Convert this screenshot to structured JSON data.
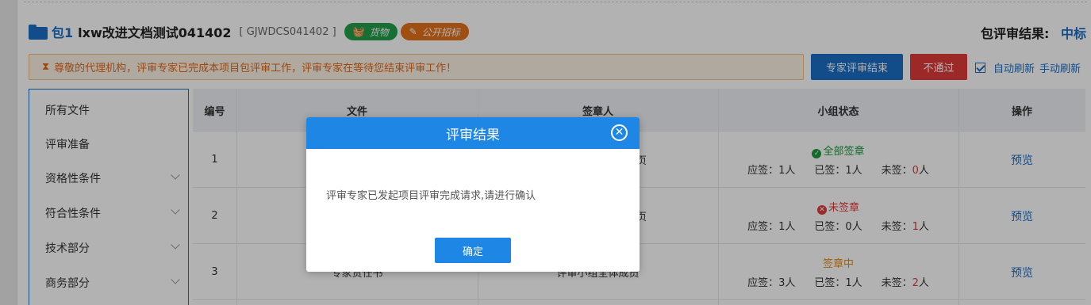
{
  "header": {
    "package_label": "包1",
    "project_name": "lxw改进文档测试041402",
    "project_code": "[ GJWDCS041402 ]",
    "tags": [
      {
        "label": "货物",
        "icon": "basket-icon",
        "color": "#21a04a"
      },
      {
        "label": "公开招标",
        "icon": "pen-icon",
        "color": "#e4711b"
      }
    ],
    "result_label": "包评审结果:",
    "result_value": "中标"
  },
  "notice": {
    "icon": "hourglass-icon",
    "text": "尊敬的代理机构，评审专家已完成本项目包评审工作，评审专家在等待您结束评审工作！"
  },
  "actions": {
    "finish_label": "专家评审结束",
    "reject_label": "不通过",
    "auto_refresh_label": "自动刷新",
    "auto_refresh_checked": true,
    "manual_refresh_label": "手动刷新"
  },
  "sidebar": {
    "items": [
      {
        "label": "所有文件",
        "expandable": false
      },
      {
        "label": "评审准备",
        "expandable": false
      },
      {
        "label": "资格性条件",
        "expandable": true
      },
      {
        "label": "符合性条件",
        "expandable": true
      },
      {
        "label": "技术部分",
        "expandable": true
      },
      {
        "label": "商务部分",
        "expandable": true
      }
    ]
  },
  "table": {
    "headers": [
      "编号",
      "文件",
      "签章人",
      "小组状态",
      "操作"
    ],
    "rows": [
      {
        "no": "1",
        "file": "",
        "signer": "页",
        "status": "全部签章",
        "status_type": "done",
        "required": "应签：1人",
        "signed": "已签：1人",
        "unsigned_label": "未签：",
        "unsigned_value": "0",
        "unsigned_unit": "人",
        "action": "预览"
      },
      {
        "no": "2",
        "file": "",
        "signer": "页",
        "status": "未签章",
        "status_type": "none",
        "required": "应签：1人",
        "signed": "已签：0人",
        "unsigned_label": "未签：",
        "unsigned_value": "1",
        "unsigned_unit": "人",
        "action": "预览"
      },
      {
        "no": "3",
        "file": "专家责任书",
        "signer": "评审小组全体成员",
        "status": "签章中",
        "status_type": "progress",
        "required": "应签：3人",
        "signed": "已签：1人",
        "unsigned_label": "未签：",
        "unsigned_value": "2",
        "unsigned_unit": "人",
        "action": "预览"
      }
    ]
  },
  "dialog": {
    "title": "评审结果",
    "message": "评审专家已发起项目评审完成请求,请进行确认",
    "ok_label": "确定",
    "close_icon": "close-circle-icon"
  },
  "colors": {
    "primary": "#1a6dc4",
    "dialog_header": "#1e86e4",
    "danger": "#e03a3a",
    "success": "#21a04a",
    "warning": "#e4711b"
  }
}
